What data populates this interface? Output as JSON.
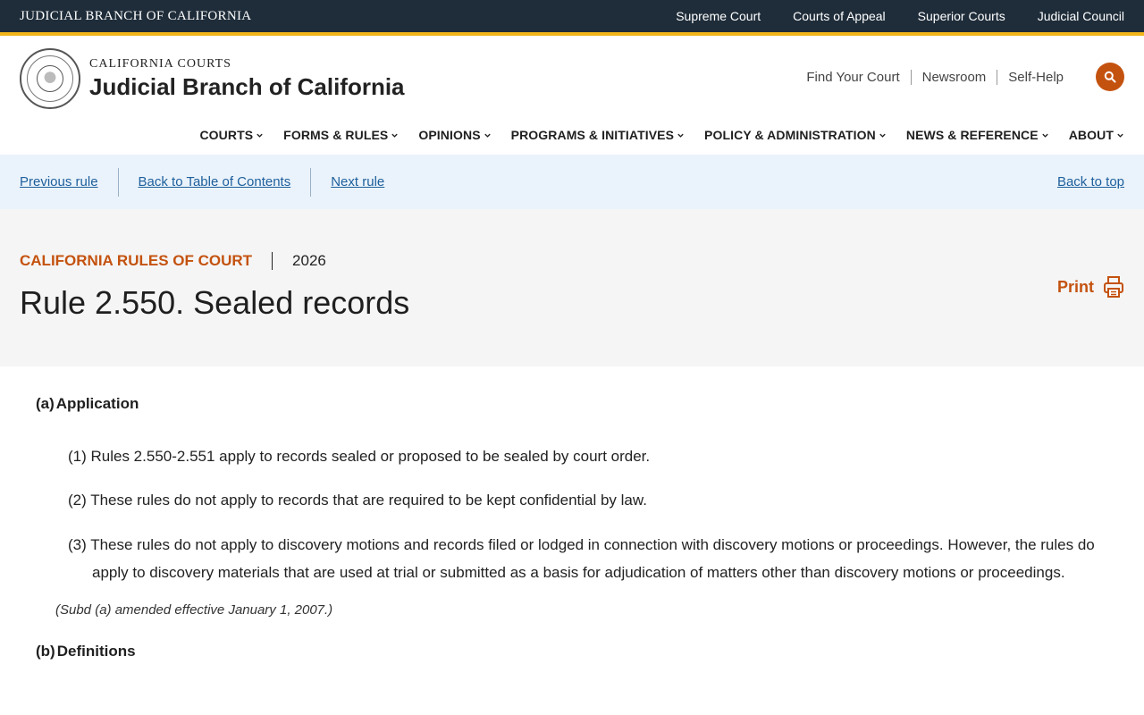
{
  "utility_bar": {
    "brand": "JUDICIAL BRANCH OF CALIFORNIA",
    "links": [
      "Supreme Court",
      "Courts of Appeal",
      "Superior Courts",
      "Judicial Council"
    ]
  },
  "header": {
    "kicker": "CALIFORNIA COURTS",
    "title": "Judicial Branch of California",
    "links": [
      "Find Your Court",
      "Newsroom",
      "Self-Help"
    ],
    "search_icon": "search-icon",
    "seal_icon": "judicial-council-seal"
  },
  "main_nav": {
    "items": [
      "COURTS",
      "FORMS & RULES",
      "OPINIONS",
      "PROGRAMS & INITIATIVES",
      "POLICY & ADMINISTRATION",
      "NEWS & REFERENCE",
      "ABOUT"
    ]
  },
  "rule_nav": {
    "previous": "Previous rule",
    "toc": "Back to Table of Contents",
    "next": "Next rule",
    "top": "Back to top"
  },
  "title_band": {
    "kicker": "CALIFORNIA RULES OF COURT",
    "year": "2026",
    "title": "Rule 2.550. Sealed records",
    "print_label": "Print"
  },
  "rule": {
    "section_a": {
      "label": "(a)",
      "heading": "Application",
      "paragraphs": [
        "(1) Rules 2.550-2.551 apply to records sealed or proposed to be sealed by court order.",
        "(2) These rules do not apply to records that are required to be kept confidential by law.",
        "(3) These rules do not apply to discovery motions and records filed or lodged in connection with discovery motions or proceedings. However, the rules do apply to discovery materials that are used at trial or submitted as a basis for adjudication of matters other than discovery motions or proceedings."
      ],
      "note": "(Subd (a) amended effective January 1, 2007.)"
    },
    "section_b": {
      "label": "(b)",
      "heading": "Definitions"
    }
  },
  "colors": {
    "utility_bg": "#1f2d3a",
    "gold_rule": "#f2b51a",
    "accent": "#c4520f",
    "link": "#1d5f9c",
    "rule_nav_bg": "#eaf3fb",
    "title_band_bg": "#f5f5f5"
  }
}
